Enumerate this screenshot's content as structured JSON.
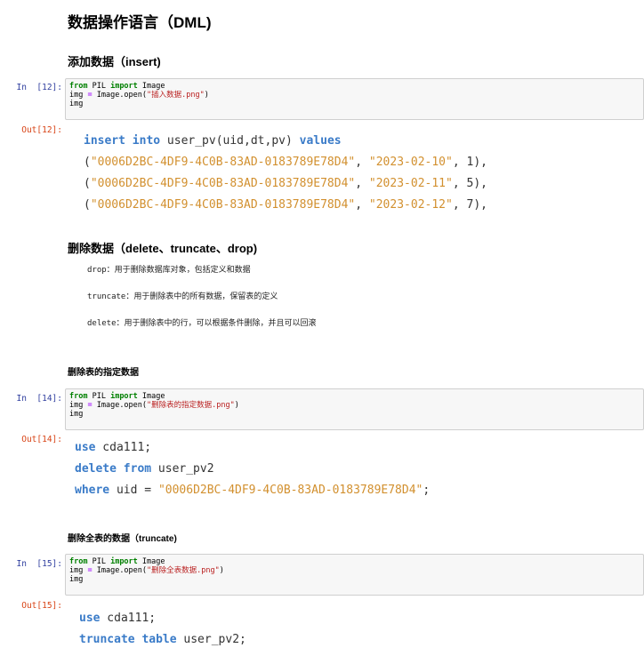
{
  "heading_main": "数据操作语言（DML)",
  "sections": {
    "insert": {
      "title": "添加数据（insert)",
      "cell": {
        "in_prompt": "In  [12]:",
        "out_prompt": "Out[12]:",
        "code": {
          "kw_from": "from",
          "module": " PIL ",
          "kw_import": "import",
          "cls": " Image",
          "line2_a": "img ",
          "line2_eq": "=",
          "line2_b": " Image.open(",
          "line2_str": "\"插入数据.png\"",
          "line2_c": ")",
          "line3": "img"
        },
        "output": {
          "line1_kw1": "insert into",
          "line1_mid": " user_pv(uid,dt,pv) ",
          "line1_kw2": "values",
          "rows": [
            {
              "open": "(",
              "id": "\"0006D2BC-4DF9-4C0B-83AD-0183789E78D4\"",
              "sep1": ", ",
              "date": "\"2023-02-10\"",
              "sep2": ", ",
              "num": "1",
              "close": "),"
            },
            {
              "open": "(",
              "id": "\"0006D2BC-4DF9-4C0B-83AD-0183789E78D4\"",
              "sep1": ", ",
              "date": "\"2023-02-11\"",
              "sep2": ", ",
              "num": "5",
              "close": "),"
            },
            {
              "open": "(",
              "id": "\"0006D2BC-4DF9-4C0B-83AD-0183789E78D4\"",
              "sep1": ", ",
              "date": "\"2023-02-12\"",
              "sep2": ", ",
              "num": "7",
              "close": "),"
            }
          ]
        }
      }
    },
    "delete": {
      "title": "删除数据（delete、truncate、drop)",
      "notes": [
        "drop：用于删除数据库对象，包括定义和数据",
        "truncate：用于删除表中的所有数据，保留表的定义",
        "delete：用于删除表中的行，可以根据条件删除，并且可以回滚"
      ]
    },
    "delete_rows": {
      "title": "删除表的指定数据",
      "cell": {
        "in_prompt": "In  [14]:",
        "out_prompt": "Out[14]:",
        "code": {
          "kw_from": "from",
          "module": " PIL ",
          "kw_import": "import",
          "cls": " Image",
          "line2_a": "img ",
          "line2_eq": "=",
          "line2_b": " Image.open(",
          "line2_str": "\"删除表的指定数据.png\"",
          "line2_c": ")",
          "line3": "img"
        },
        "output": {
          "l1_kw": "use",
          "l1_rest": " cda111;",
          "l2_kw1": "delete from",
          "l2_rest": " user_pv2",
          "l3_kw": "where",
          "l3_mid": " uid = ",
          "l3_str": "\"0006D2BC-4DF9-4C0B-83AD-0183789E78D4\"",
          "l3_end": ";"
        }
      }
    },
    "truncate": {
      "title": "删除全表的数据（truncate)",
      "cell": {
        "in_prompt": "In  [15]:",
        "out_prompt": "Out[15]:",
        "code": {
          "kw_from": "from",
          "module": " PIL ",
          "kw_import": "import",
          "cls": " Image",
          "line2_a": "img ",
          "line2_eq": "=",
          "line2_b": " Image.open(",
          "line2_str": "\"删除全表数据.png\"",
          "line2_c": ")",
          "line3": "img"
        },
        "output": {
          "l1_kw": "use",
          "l1_rest": " cda111;",
          "l2_kw": "truncate table",
          "l2_rest": " user_pv2;"
        }
      }
    }
  }
}
